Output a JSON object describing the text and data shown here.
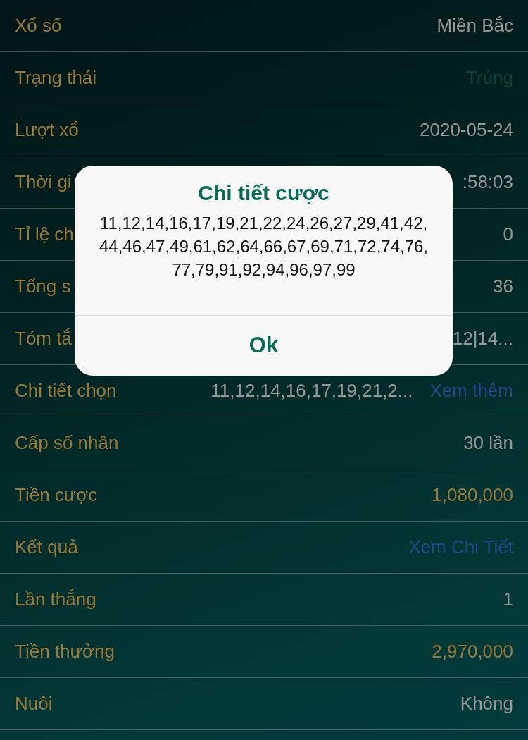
{
  "rows": [
    {
      "label": "Xổ số",
      "value": "Miền Bắc",
      "kind": "plain"
    },
    {
      "label": "Trạng thái",
      "value": "Trúng",
      "kind": "status"
    },
    {
      "label": "Lượt xổ",
      "value": "2020-05-24",
      "kind": "plain"
    },
    {
      "label": "Thời gi",
      "value": ":58:03",
      "kind": "plain"
    },
    {
      "label": "Tỉ lệ ch",
      "value": "0",
      "kind": "plain"
    },
    {
      "label": "Tổng s",
      "value": "36",
      "kind": "plain"
    },
    {
      "label": "Tóm tắ",
      "value": "12|14...",
      "kind": "plain"
    },
    {
      "label": "Chi tiết chọn",
      "value": "11,12,14,16,17,19,21,2...",
      "link": "Xem thêm",
      "kind": "plain"
    },
    {
      "label": "Cấp số nhân",
      "value": "30 lần",
      "kind": "plain"
    },
    {
      "label": "Tiền cược",
      "value": "1,080,000",
      "kind": "money"
    },
    {
      "label": "Kết quả",
      "link": "Xem Chi Tiết"
    },
    {
      "label": "Lần thắng",
      "value": "1",
      "kind": "plain"
    },
    {
      "label": "Tiền thưởng",
      "value": "2,970,000",
      "kind": "money"
    },
    {
      "label": "Nuôi",
      "value": "Không",
      "kind": "plain"
    }
  ],
  "dialog": {
    "title": "Chi tiết cược",
    "message": "11,12,14,16,17,19,21,22,24,26,27,29,41,42,44,46,47,49,61,62,64,66,67,69,71,72,74,76,77,79,91,92,94,96,97,99",
    "button": "Ok"
  }
}
